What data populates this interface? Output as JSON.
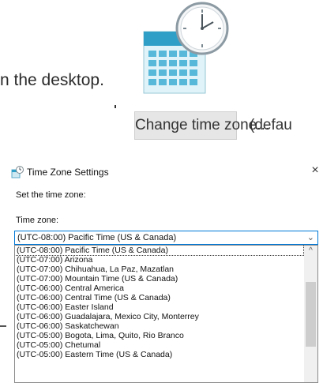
{
  "background": {
    "desktop_text": "n the desktop.",
    "calendar_icon": "calendar-clock-icon",
    "change_button_label": "Change time zone...",
    "default_text": "(defau"
  },
  "dialog": {
    "title": "Time Zone Settings",
    "title_icon": "clock-settings-icon",
    "close_glyph": "×",
    "set_label": "Set the time zone:",
    "timezone_label": "Time zone:",
    "selected_value": "(UTC-08:00) Pacific Time (US & Canada)",
    "chevron": "⌄",
    "options": [
      "(UTC-08:00) Pacific Time (US & Canada)",
      "(UTC-07:00) Arizona",
      "(UTC-07:00) Chihuahua, La Paz, Mazatlan",
      "(UTC-07:00) Mountain Time (US & Canada)",
      "(UTC-06:00) Central America",
      "(UTC-06:00) Central Time (US & Canada)",
      "(UTC-06:00) Easter Island",
      "(UTC-06:00) Guadalajara, Mexico City, Monterrey",
      "(UTC-06:00) Saskatchewan",
      "(UTC-05:00) Bogota, Lima, Quito, Rio Branco",
      "(UTC-05:00) Chetumal",
      "(UTC-05:00) Eastern Time (US & Canada)"
    ],
    "scroll_up_glyph": "^"
  }
}
